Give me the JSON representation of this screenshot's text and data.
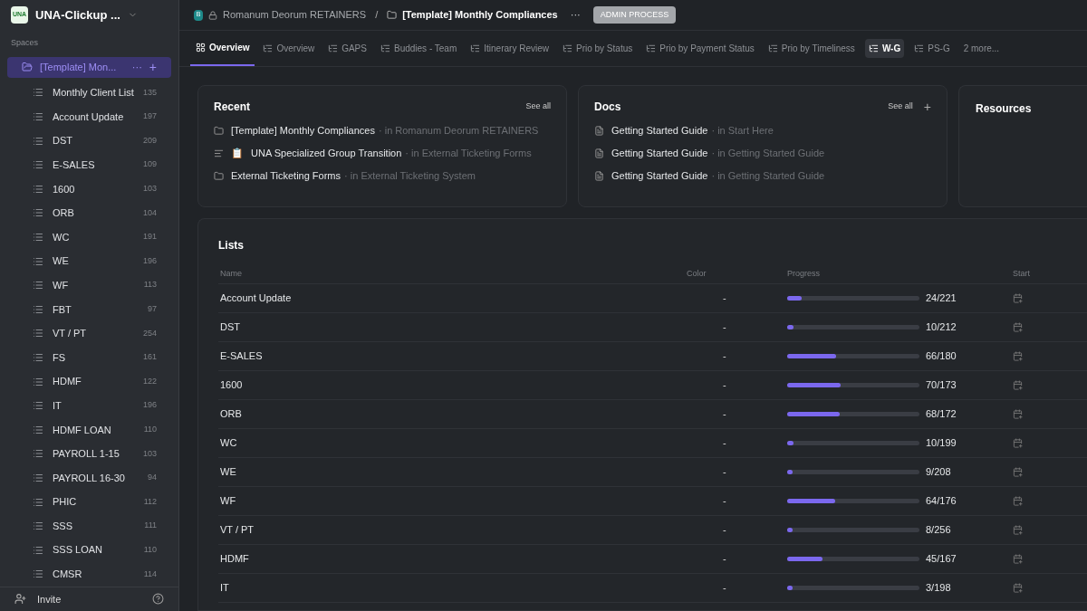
{
  "workspace": {
    "logo": "UNA",
    "name": "UNA-Clickup ..."
  },
  "sidebar": {
    "section": "Spaces",
    "space": {
      "name": "[Template] Mon...",
      "selected": true,
      "more": "···",
      "add": "+"
    },
    "items": [
      {
        "name": "Monthly Client List",
        "count": "135"
      },
      {
        "name": "Account Update",
        "count": "197"
      },
      {
        "name": "DST",
        "count": "209"
      },
      {
        "name": "E-SALES",
        "count": "109"
      },
      {
        "name": "1600",
        "count": "103"
      },
      {
        "name": "ORB",
        "count": "104"
      },
      {
        "name": "WC",
        "count": "191"
      },
      {
        "name": "WE",
        "count": "196"
      },
      {
        "name": "WF",
        "count": "113"
      },
      {
        "name": "FBT",
        "count": "97"
      },
      {
        "name": "VT / PT",
        "count": "254"
      },
      {
        "name": "FS",
        "count": "161"
      },
      {
        "name": "HDMF",
        "count": "122"
      },
      {
        "name": "IT",
        "count": "196"
      },
      {
        "name": "HDMF LOAN",
        "count": "110"
      },
      {
        "name": "PAYROLL 1-15",
        "count": "103"
      },
      {
        "name": "PAYROLL 16-30",
        "count": "94"
      },
      {
        "name": "PHIC",
        "count": "112"
      },
      {
        "name": "SSS",
        "count": "111"
      },
      {
        "name": "SSS LOAN",
        "count": "110"
      },
      {
        "name": "CMSR",
        "count": "114"
      }
    ],
    "invite": "Invite"
  },
  "breadcrumb": {
    "space_badge": "B",
    "space": "Romanum Deorum RETAINERS",
    "separator": "/",
    "folder": "[Template] Monthly Compliances",
    "more": "···",
    "tag": "ADMIN PROCESS"
  },
  "tabs": [
    {
      "label": "Overview",
      "kind": "overview",
      "selected": true,
      "hovered": false
    },
    {
      "label": "Overview",
      "kind": "list",
      "selected": false,
      "hovered": false
    },
    {
      "label": "GAPS",
      "kind": "list",
      "selected": false,
      "hovered": false
    },
    {
      "label": "Buddies - Team",
      "kind": "list",
      "selected": false,
      "hovered": false
    },
    {
      "label": "Itinerary Review",
      "kind": "list",
      "selected": false,
      "hovered": false
    },
    {
      "label": "Prio by Status",
      "kind": "list",
      "selected": false,
      "hovered": false
    },
    {
      "label": "Prio by Payment Status",
      "kind": "list",
      "selected": false,
      "hovered": false
    },
    {
      "label": "Prio by Timeliness",
      "kind": "list",
      "selected": false,
      "hovered": false
    },
    {
      "label": "W-G",
      "kind": "list",
      "selected": false,
      "hovered": true
    },
    {
      "label": "PS-G",
      "kind": "list",
      "selected": false,
      "hovered": false
    }
  ],
  "more_tabs": "2 more...",
  "recent": {
    "title": "Recent",
    "see_all": "See all",
    "items": [
      {
        "kind": "folder",
        "name": "[Template] Monthly Compliances",
        "location": "· in Romanum Deorum RETAINERS"
      },
      {
        "kind": "doc",
        "emoji": "📋",
        "name": "UNA Specialized Group Transition",
        "location": "· in External Ticketing Forms"
      },
      {
        "kind": "folder",
        "name": "External Ticketing Forms",
        "location": "· in External Ticketing System"
      }
    ]
  },
  "docs": {
    "title": "Docs",
    "see_all": "See all",
    "add": "+",
    "items": [
      {
        "name": "Getting Started Guide",
        "location": "· in Start Here"
      },
      {
        "name": "Getting Started Guide",
        "location": "· in Getting Started Guide"
      },
      {
        "name": "Getting Started Guide",
        "location": "· in Getting Started Guide"
      }
    ]
  },
  "resources": {
    "title": "Resources"
  },
  "lists": {
    "title": "Lists",
    "columns": [
      "Name",
      "Color",
      "Progress",
      "Start"
    ],
    "rows": [
      {
        "name": "Account Update",
        "color_cell": "-",
        "level": 0.109,
        "progress": "24/221"
      },
      {
        "name": "DST",
        "color_cell": "-",
        "level": 0.047,
        "progress": "10/212"
      },
      {
        "name": "E-SALES",
        "color_cell": "-",
        "level": 0.367,
        "progress": "66/180"
      },
      {
        "name": "1600",
        "color_cell": "-",
        "level": 0.405,
        "progress": "70/173"
      },
      {
        "name": "ORB",
        "color_cell": "-",
        "level": 0.395,
        "progress": "68/172"
      },
      {
        "name": "WC",
        "color_cell": "-",
        "level": 0.05,
        "progress": "10/199"
      },
      {
        "name": "WE",
        "color_cell": "-",
        "level": 0.043,
        "progress": "9/208"
      },
      {
        "name": "WF",
        "color_cell": "-",
        "level": 0.364,
        "progress": "64/176"
      },
      {
        "name": "VT / PT",
        "color_cell": "-",
        "level": 0.031,
        "progress": "8/256"
      },
      {
        "name": "HDMF",
        "color_cell": "-",
        "level": 0.27,
        "progress": "45/167"
      },
      {
        "name": "IT",
        "color_cell": "-",
        "level": 0.015,
        "progress": "3/198"
      }
    ]
  }
}
